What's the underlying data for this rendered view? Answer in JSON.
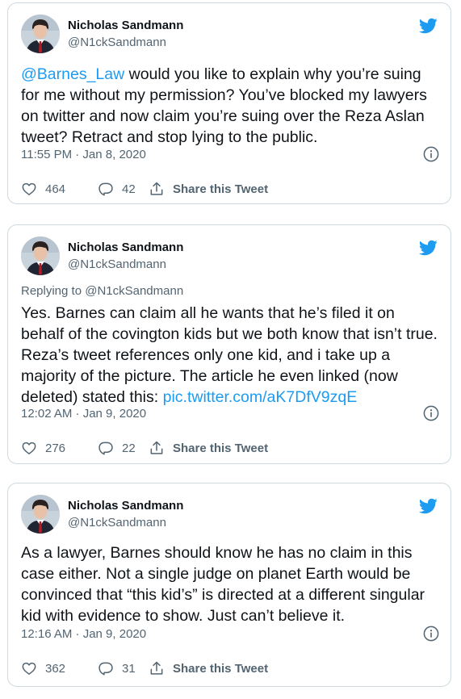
{
  "tweets": [
    {
      "author": {
        "name": "Nicholas Sandmann",
        "handle": "@N1ckSandmann"
      },
      "replying_to": null,
      "mention": "@Barnes_Law",
      "text": " would you like to explain why you’re suing for me without my permission? You’ve blocked my lawyers on twitter and now claim you’re suing over the Reza Aslan tweet? Retract and stop lying to the public.",
      "timestamp": "11:55 PM · Jan 8, 2020",
      "likes": "464",
      "replies": "42",
      "share_label": "Share this Tweet"
    },
    {
      "author": {
        "name": "Nicholas Sandmann",
        "handle": "@N1ckSandmann"
      },
      "replying_to": "Replying to @N1ckSandmann",
      "text": "Yes. Barnes can claim all he wants that he’s filed it on behalf of the covington kids but we both know that isn’t true. Reza’s tweet references only one kid, and i take up a majority of the picture. The article he even linked (now deleted) stated this: ",
      "link": "pic.twitter.com/aK7DfV9zqE",
      "timestamp": "12:02 AM · Jan 9, 2020",
      "likes": "276",
      "replies": "22",
      "share_label": "Share this Tweet"
    },
    {
      "author": {
        "name": "Nicholas Sandmann",
        "handle": "@N1ckSandmann"
      },
      "replying_to": null,
      "text": "As a lawyer, Barnes should know he has no claim in this case either. Not a single judge on planet Earth would be convinced that “this kid’s” is directed at a different singular kid with evidence to show. Just can’t believe it.",
      "timestamp": "12:16 AM · Jan 9, 2020",
      "likes": "362",
      "replies": "31",
      "share_label": "Share this Tweet"
    }
  ],
  "colors": {
    "accent": "#1d9bf0",
    "text": "#0f1419",
    "muted": "#536471",
    "border": "#cfd9de"
  },
  "icons": [
    "avatar-photo",
    "twitter-bird-icon",
    "info-icon",
    "heart-icon",
    "reply-bubble-icon",
    "share-icon"
  ]
}
